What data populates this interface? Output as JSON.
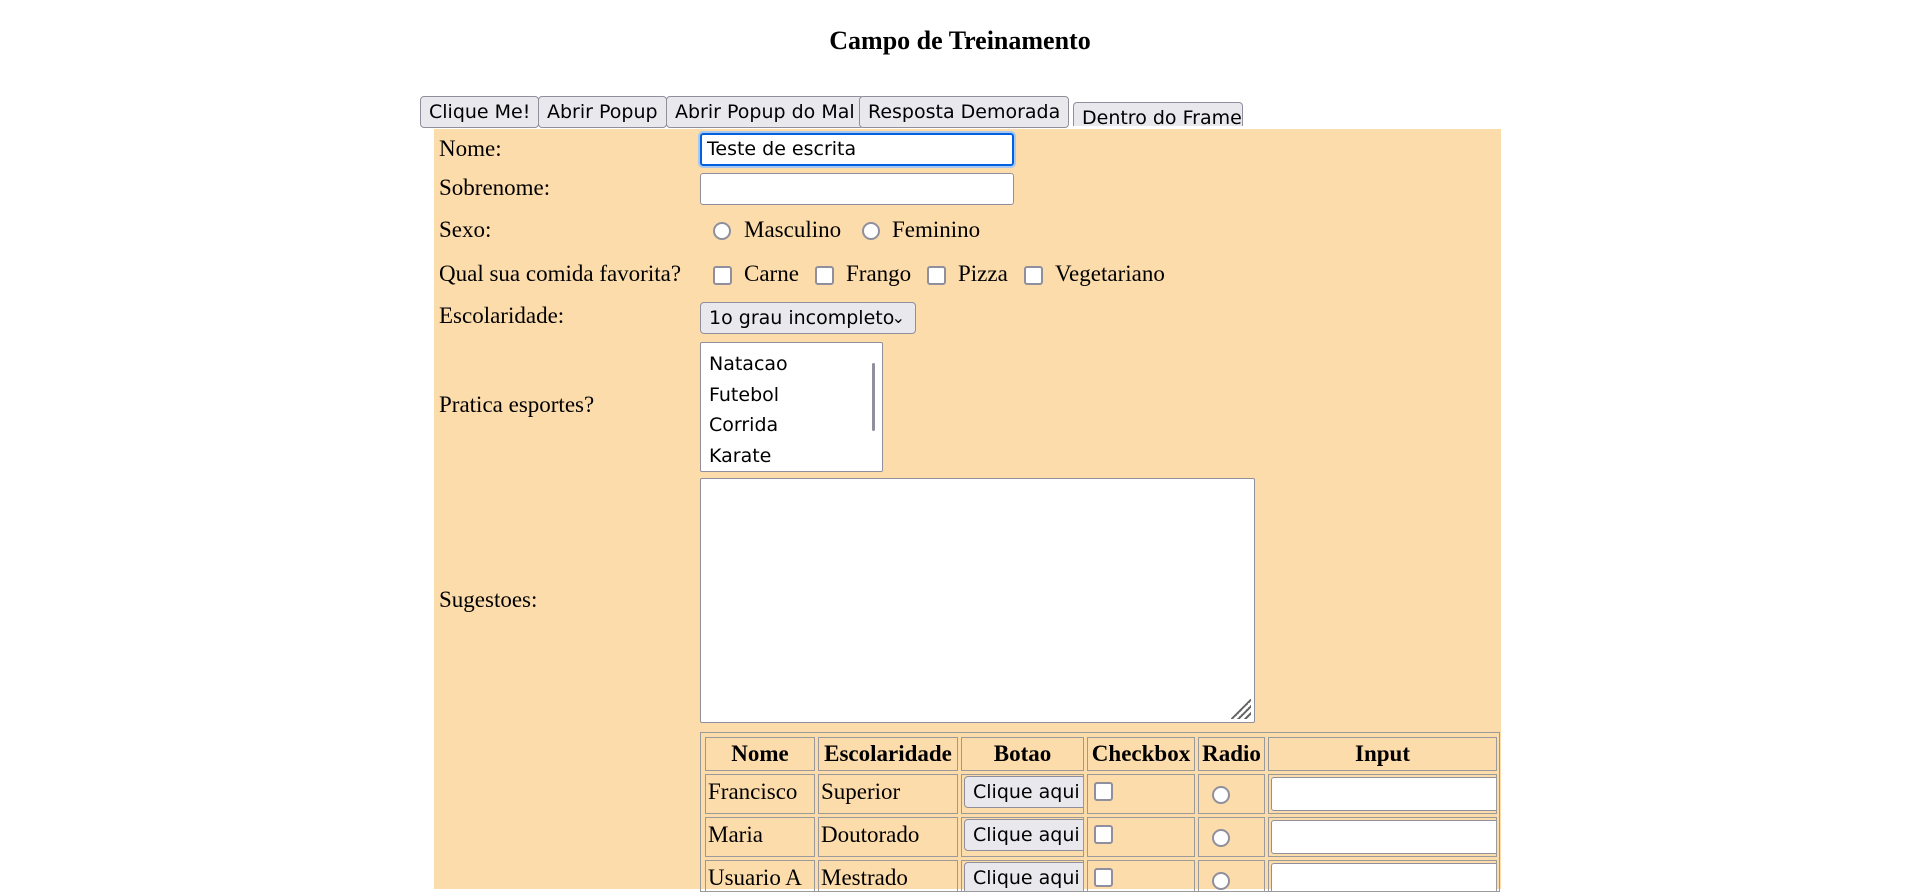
{
  "title": "Campo de Treinamento",
  "toolbar": {
    "buttons": [
      "Clique Me!",
      "Abrir Popup",
      "Abrir Popup do Mal",
      "Resposta Demorada"
    ],
    "frame_button": "Dentro do Frame"
  },
  "form": {
    "nome_label": "Nome:",
    "nome_value": "Teste de escrita",
    "sobrenome_label": "Sobrenome:",
    "sobrenome_value": "",
    "sexo_label": "Sexo:",
    "sexo_options": [
      "Masculino",
      "Feminino"
    ],
    "comida_label": "Qual sua comida favorita?",
    "comida_options": [
      "Carne",
      "Frango",
      "Pizza",
      "Vegetariano"
    ],
    "escolaridade_label": "Escolaridade:",
    "escolaridade_selected": "1o grau incompleto",
    "esportes_label": "Pratica esportes?",
    "esportes_options": [
      "Natacao",
      "Futebol",
      "Corrida",
      "Karate"
    ],
    "sugestoes_label": "Sugestoes:",
    "sugestoes_value": ""
  },
  "table": {
    "headers": [
      "Nome",
      "Escolaridade",
      "Botao",
      "Checkbox",
      "Radio",
      "Input"
    ],
    "button_label": "Clique aqui",
    "rows": [
      {
        "nome": "Francisco",
        "escolaridade": "Superior"
      },
      {
        "nome": "Maria",
        "escolaridade": "Doutorado"
      },
      {
        "nome": "Usuario A",
        "escolaridade": "Mestrado"
      }
    ]
  },
  "icons": {
    "select_arrow": "chevron-down-icon",
    "textarea_grip": "resize-grip-icon"
  }
}
